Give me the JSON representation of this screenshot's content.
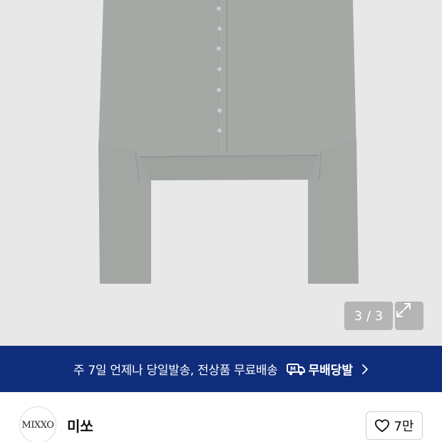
{
  "gallery": {
    "counter": "3 / 3",
    "background_color": "#e8e8e8",
    "garment_color": "#a6aaa7"
  },
  "banner": {
    "text": "주 7일 언제나 당일발송, 전상품 무료배송",
    "badge_label": "무배당발",
    "background_color": "#0f2d7a"
  },
  "seller": {
    "logo_text": "MIXXO",
    "name": "미쏘",
    "likes": "7만"
  }
}
